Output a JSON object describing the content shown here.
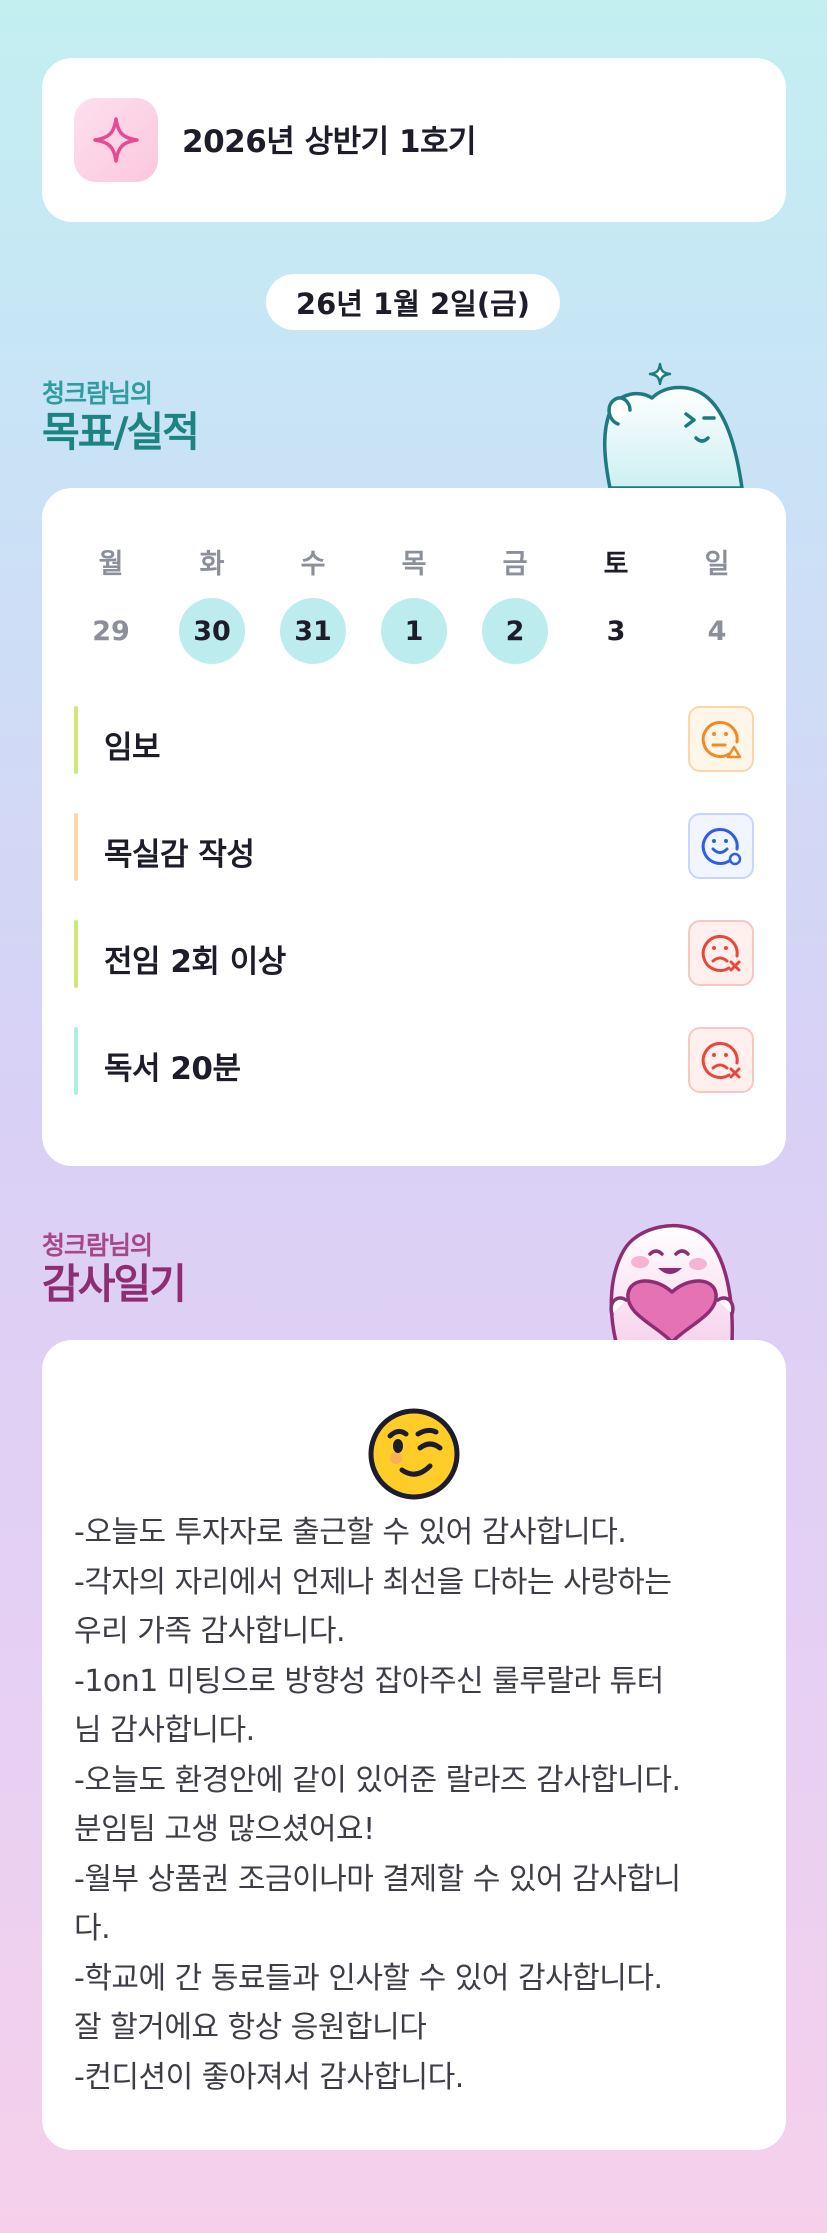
{
  "cohort": {
    "title": "2026년 상반기 1호기",
    "icon": "sparkle-icon"
  },
  "date_label": "26년 1월 2일(금)",
  "goals_section": {
    "subtitle": "청크람님의",
    "title": "목표/실적"
  },
  "week": {
    "days": [
      "월",
      "화",
      "수",
      "목",
      "금",
      "토",
      "일"
    ],
    "dates": [
      "29",
      "30",
      "31",
      "1",
      "2",
      "3",
      "4"
    ],
    "completed": [
      false,
      true,
      true,
      true,
      true,
      false,
      false
    ]
  },
  "goals": [
    {
      "label": "임보",
      "status": "partial",
      "status_icon": "face-warning-icon",
      "accent": "#cbe97a"
    },
    {
      "label": "목실감 작성",
      "status": "done",
      "status_icon": "face-smile-check-icon",
      "accent": "#fbd9a3"
    },
    {
      "label": "전임 2회 이상",
      "status": "failed",
      "status_icon": "face-sad-x-icon",
      "accent": "#cbe97a"
    },
    {
      "label": "독서 20분",
      "status": "failed",
      "status_icon": "face-sad-x-icon",
      "accent": "#aef0e0"
    }
  ],
  "thanks_section": {
    "subtitle": "청크람님의",
    "title": "감사일기",
    "emoji": "winking-face-icon"
  },
  "thanks_lines": [
    "-오늘도 투자자로 출근할 수 있어 감사합니다.",
    "-각자의 자리에서 언제나 최선을 다하는 사랑하는",
    "우리 가족 감사합니다.",
    "-1on1 미팅으로 방향성 잡아주신 룰루랄라 튜터",
    "님 감사합니다.",
    "-오늘도 환경안에 같이 있어준 랄라즈 감사합니다.",
    "분임팀 고생 많으셨어요!",
    "-월부 상품권 조금이나마 결제할 수 있어 감사합니",
    "다.",
    "-학교에 간 동료들과 인사할 수 있어 감사합니다.",
    "잘 할거에요 항상 응원합니다",
    "-컨디션이 좋아져서 감사합니다."
  ]
}
